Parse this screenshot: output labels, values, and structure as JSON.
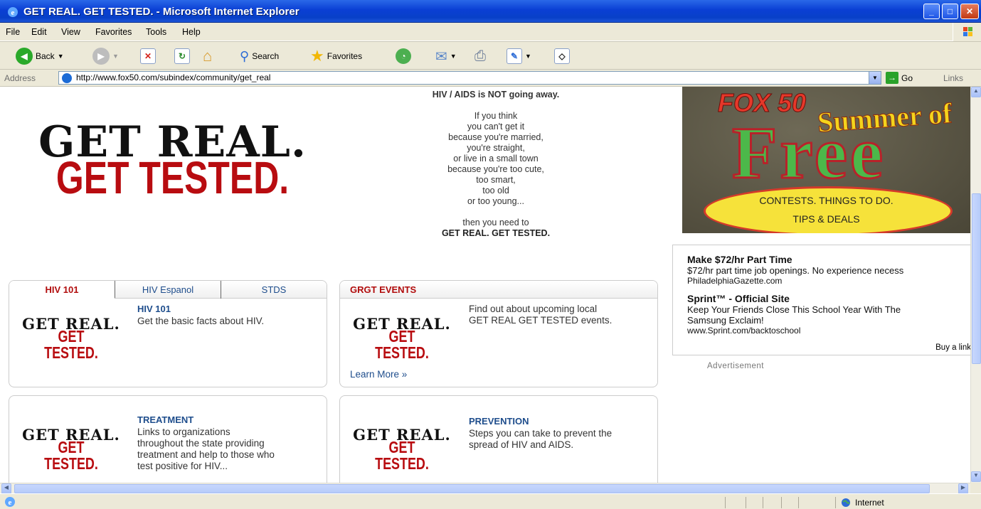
{
  "window": {
    "title": "GET REAL. GET TESTED. - Microsoft Internet Explorer",
    "controls": {
      "minimize": "_",
      "maximize": "□",
      "close": "✕"
    }
  },
  "menu": {
    "file": "File",
    "edit": "Edit",
    "view": "View",
    "favorites": "Favorites",
    "tools": "Tools",
    "help": "Help"
  },
  "toolbar": {
    "back": "Back",
    "search": "Search",
    "favorites": "Favorites"
  },
  "address": {
    "label": "Address",
    "url": "http://www.fox50.com/subindex/community/get_real",
    "go": "Go",
    "links": "Links"
  },
  "logo": {
    "line1": "GET REAL.",
    "line2": "GET TESTED."
  },
  "poem": {
    "heading": "HIV / AIDS is NOT going away.",
    "lines": [
      "If you think",
      "you can't get it",
      "because you're married,",
      "you're straight,",
      "or live in a small town",
      "because you're too cute,",
      "too smart,",
      "too old",
      "or too young..."
    ],
    "closing": "then you need to",
    "closing_bold": "GET REAL. GET TESTED."
  },
  "fox_ad": {
    "brand": "FOX 50",
    "line1": "Summer of",
    "line2": "Free",
    "banner1": "CONTESTS. THINGS TO DO.",
    "banner2": "TIPS & DEALS"
  },
  "text_ads": {
    "ads": [
      {
        "headline": "Make $72/hr Part Time",
        "description": "$72/hr part time job openings. No experience necess",
        "url": "PhiladelphiaGazette.com"
      },
      {
        "headline": "Sprint™ - Official Site",
        "description": "Keep Your Friends Close This School Year With The",
        "description2": "Samsung Exclaim!",
        "url": "www.Sprint.com/backtoschool"
      }
    ],
    "buy_link": "Buy a link",
    "advertisement": "Advertisement"
  },
  "panels": {
    "hiv101": {
      "tabs": [
        "HIV 101",
        "HIV Espanol",
        "STDS"
      ],
      "title": "HIV 101",
      "text": "Get the basic facts about HIV."
    },
    "events": {
      "header": "GRGT EVENTS",
      "text1": "Find out about upcoming local",
      "text2": "GET REAL GET TESTED events.",
      "learn_more": "Learn More »"
    },
    "treatment": {
      "title": "TREATMENT",
      "lines": [
        "Links to organizations",
        "throughout the state providing",
        "treatment and help to those who",
        "test positive for HIV..."
      ]
    },
    "prevention": {
      "title": "PREVENTION",
      "lines": [
        "Steps you can take to prevent the",
        "spread of HIV and AIDS."
      ]
    }
  },
  "status": {
    "zone": "Internet"
  },
  "colors": {
    "xp_blue": "#0a3fd4",
    "chrome": "#ece9d8",
    "logo_red": "#b80c10",
    "link_blue": "#1e4d8c"
  }
}
